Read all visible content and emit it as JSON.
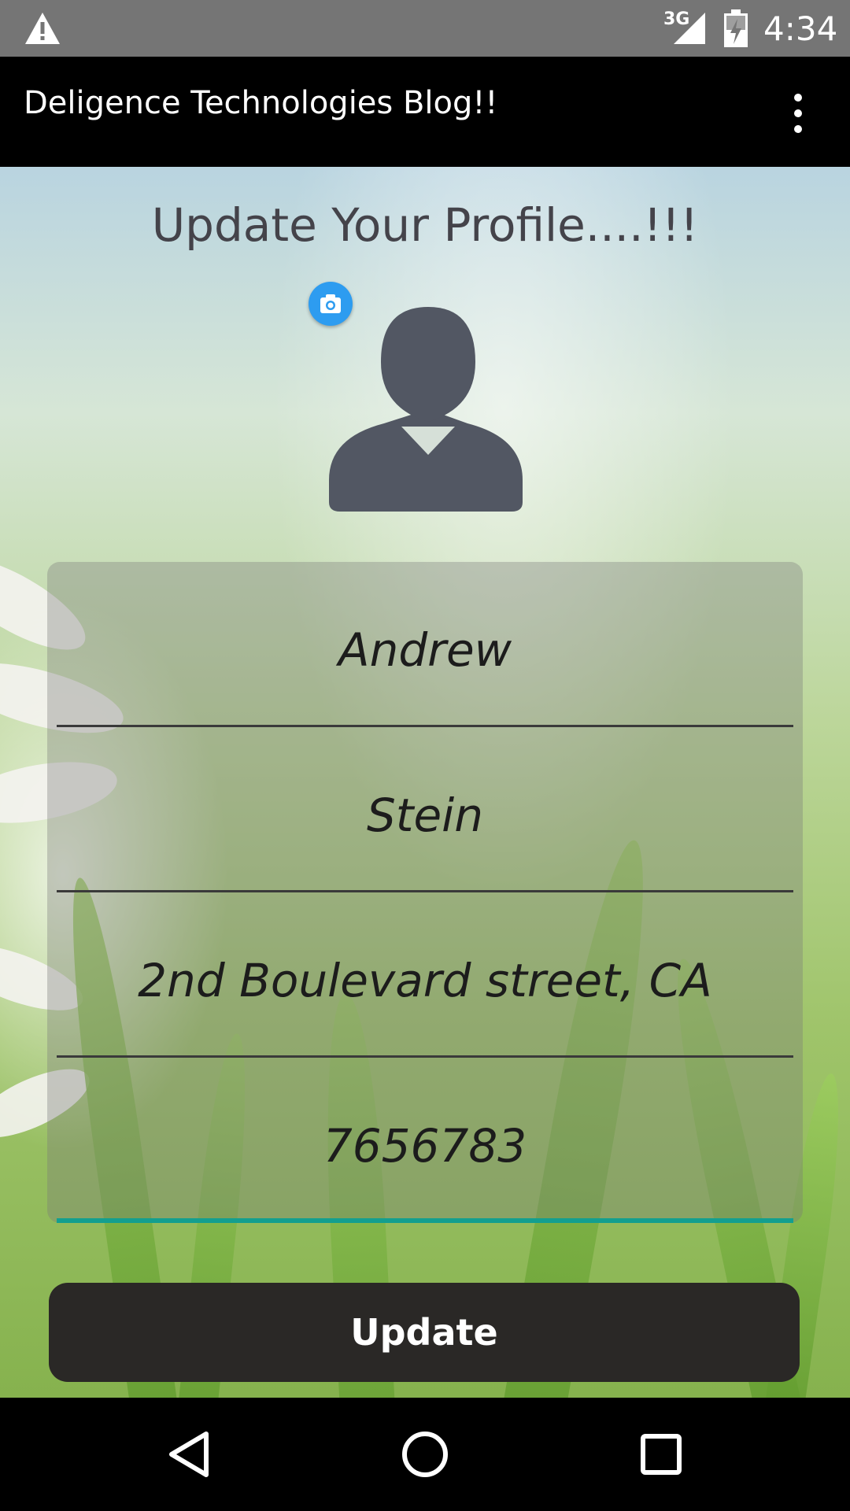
{
  "status_bar": {
    "network": "3G",
    "time": "4:34",
    "icons": [
      "warning-icon",
      "signal-icon",
      "battery-charging-icon"
    ]
  },
  "app_bar": {
    "title": "Deligence Technologies Blog!!",
    "menu_icon": "overflow-menu-icon"
  },
  "profile": {
    "heading": "Update Your Profile....!!!",
    "avatar_icon": "person-avatar-icon",
    "camera_icon": "camera-icon"
  },
  "form": {
    "fields": [
      {
        "name": "first-name",
        "value": "Andrew"
      },
      {
        "name": "last-name",
        "value": "Stein"
      },
      {
        "name": "address",
        "value": "2nd Boulevard street, CA"
      },
      {
        "name": "phone",
        "value": "7656783"
      }
    ],
    "accent_color": "#139f8f",
    "submit_label": "Update"
  },
  "nav_bar": {
    "icons": [
      "back-icon",
      "home-icon",
      "recents-icon"
    ]
  }
}
